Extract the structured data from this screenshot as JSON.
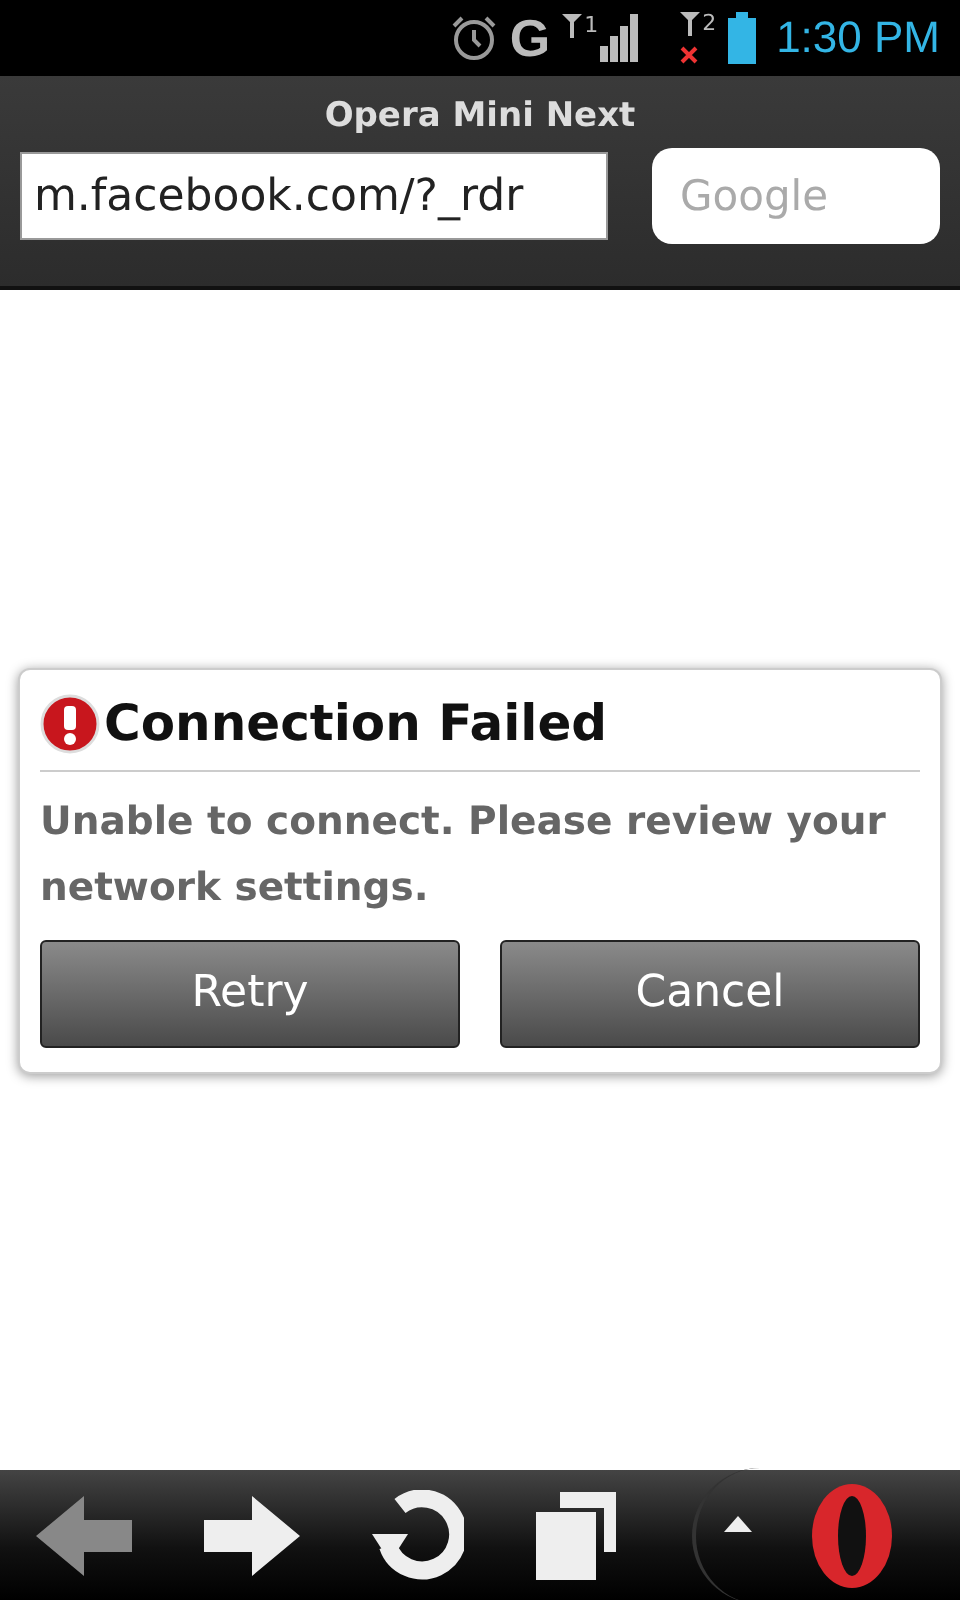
{
  "status_bar": {
    "network": "G",
    "sim1": "1",
    "sim2": "2",
    "sim2_no_signal": true,
    "time": "1:30 PM"
  },
  "header": {
    "title": "Opera Mini Next",
    "address": {
      "value": "m.facebook.com/?_rdr"
    },
    "search": {
      "placeholder": "Google"
    }
  },
  "dialog": {
    "title": "Connection Failed",
    "message": "Unable to connect. Please review your network settings.",
    "buttons": [
      "Retry",
      "Cancel"
    ]
  },
  "toolbar": [
    {
      "kind": "back",
      "disabled": true
    },
    {
      "kind": "forward",
      "disabled": false
    },
    {
      "kind": "reload",
      "disabled": false
    },
    {
      "kind": "tabs",
      "disabled": false
    },
    {
      "kind": "menu",
      "disabled": false
    }
  ]
}
